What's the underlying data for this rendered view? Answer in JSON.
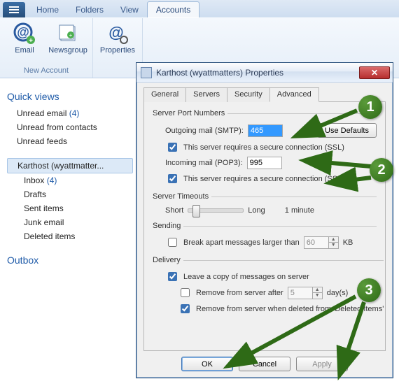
{
  "ribbon_tabs": {
    "home": "Home",
    "folders": "Folders",
    "view": "View",
    "accounts": "Accounts"
  },
  "ribbon": {
    "email": "Email",
    "newsgroup": "Newsgroup",
    "properties": "Properties",
    "group_new": "New Account"
  },
  "nav": {
    "quick_heading": "Quick views",
    "unread_email": "Unread email",
    "unread_email_count": "(4)",
    "unread_contacts": "Unread from contacts",
    "unread_feeds": "Unread feeds",
    "account_name": "Karthost (wyattmatter...",
    "inbox": "Inbox",
    "inbox_count": "(4)",
    "drafts": "Drafts",
    "sent": "Sent items",
    "junk": "Junk email",
    "deleted": "Deleted items",
    "outbox": "Outbox"
  },
  "dialog": {
    "title": "Karthost (wyattmatters) Properties",
    "tabs": {
      "general": "General",
      "servers": "Servers",
      "security": "Security",
      "advanced": "Advanced"
    },
    "ports_legend": "Server Port Numbers",
    "smtp_label": "Outgoing mail (SMTP):",
    "smtp_value": "465",
    "use_defaults": "Use Defaults",
    "ssl_required": "This server requires a secure connection (SSL)",
    "pop3_label": "Incoming mail (POP3):",
    "pop3_value": "995",
    "timeouts_legend": "Server Timeouts",
    "short": "Short",
    "long": "Long",
    "timeout_value": "1 minute",
    "sending_legend": "Sending",
    "break_apart": "Break apart messages larger than",
    "break_value": "60",
    "kb": "KB",
    "delivery_legend": "Delivery",
    "leave_copy": "Leave a copy of messages on server",
    "remove_after": "Remove from server after",
    "remove_days": "5",
    "days": "day(s)",
    "remove_deleted": "Remove from server when deleted from 'Deleted Items'",
    "ok": "OK",
    "cancel": "Cancel",
    "apply": "Apply"
  },
  "annotations": {
    "b1": "1",
    "b2": "2",
    "b3": "3"
  }
}
